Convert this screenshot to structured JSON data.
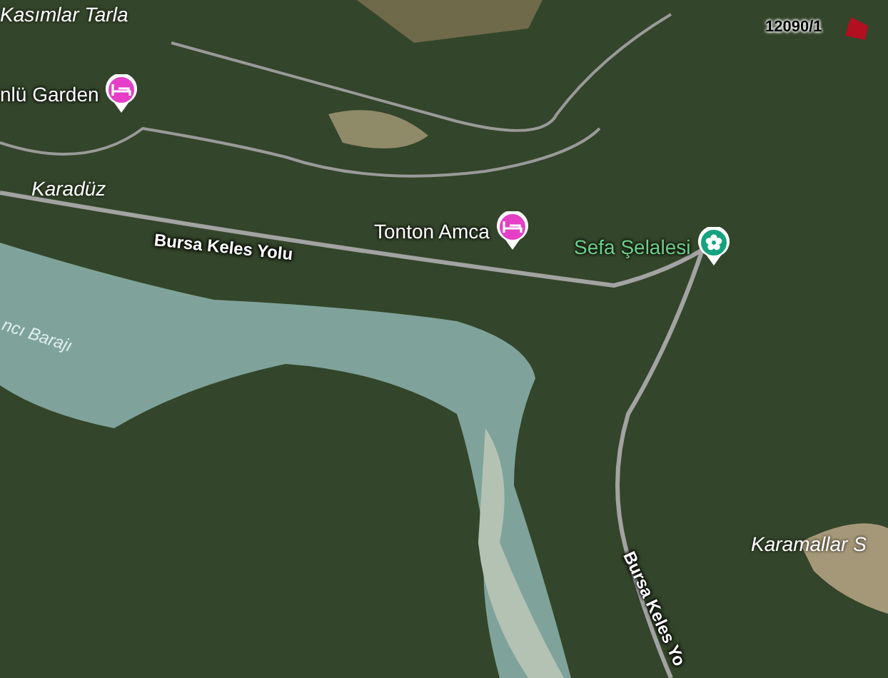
{
  "map": {
    "labels": [
      {
        "kind": "area",
        "text": "Kasımlar Tarla"
      },
      {
        "kind": "hotel",
        "text": "nlü Garden"
      },
      {
        "kind": "area",
        "text": "Karadüz"
      },
      {
        "kind": "road",
        "text": "Bursa Keles Yolu"
      },
      {
        "kind": "hotel",
        "text": "Tonton Amca"
      },
      {
        "kind": "park",
        "text": "Sefa Şelalesi"
      },
      {
        "kind": "water",
        "text": "ncı Barajı"
      },
      {
        "kind": "parcel",
        "text": "12090/1"
      },
      {
        "kind": "area",
        "text": "Karamallar S"
      },
      {
        "kind": "road",
        "text": "Bursa Keles Yo"
      }
    ]
  }
}
